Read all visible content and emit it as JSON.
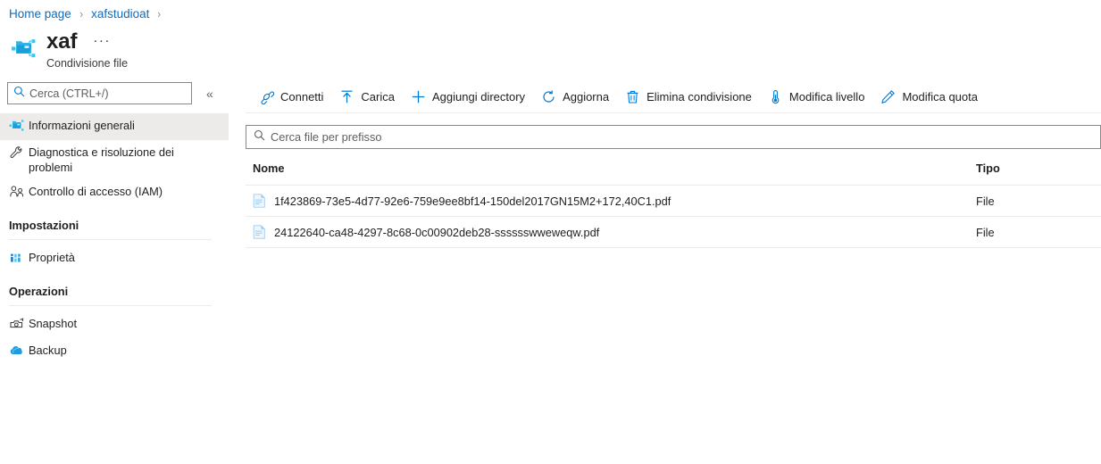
{
  "breadcrumb": {
    "items": [
      {
        "label": "Home page"
      },
      {
        "label": "xafstudioat"
      }
    ],
    "separator": "›"
  },
  "header": {
    "icon": "file-share-icon",
    "title": "xaf",
    "subtitle": "Condivisione file",
    "more_label": "···"
  },
  "sidebar": {
    "search": {
      "placeholder": "Cerca (CTRL+/)",
      "value": "",
      "icon": "search-icon"
    },
    "collapse_label": "«",
    "items": [
      {
        "label": "Informazioni generali",
        "icon": "file-share-icon",
        "selected": true
      },
      {
        "label": "Diagnostica e risoluzione dei problemi",
        "icon": "wrench-icon",
        "selected": false
      },
      {
        "label": "Controllo di accesso (IAM)",
        "icon": "people-icon",
        "selected": false
      }
    ],
    "groups": [
      {
        "title": "Impostazioni",
        "items": [
          {
            "label": "Proprietà",
            "icon": "properties-bars-icon"
          }
        ]
      },
      {
        "title": "Operazioni",
        "items": [
          {
            "label": "Snapshot",
            "icon": "camera-icon"
          },
          {
            "label": "Backup",
            "icon": "cloud-backup-icon"
          }
        ]
      }
    ]
  },
  "toolbar": {
    "commands": [
      {
        "label": "Connetti",
        "icon": "plug-connect-icon"
      },
      {
        "label": "Carica",
        "icon": "upload-arrow-icon"
      },
      {
        "label": "Aggiungi directory",
        "icon": "plus-icon"
      },
      {
        "label": "Aggiorna",
        "icon": "refresh-icon"
      },
      {
        "label": "Elimina condivisione",
        "icon": "trash-icon"
      },
      {
        "label": "Modifica livello",
        "icon": "thermometer-icon"
      },
      {
        "label": "Modifica quota",
        "icon": "pencil-icon"
      }
    ]
  },
  "file_browser": {
    "search": {
      "placeholder": "Cerca file per prefisso",
      "value": "",
      "icon": "search-icon"
    },
    "columns": [
      {
        "key": "name",
        "label": "Nome"
      },
      {
        "key": "type",
        "label": "Tipo"
      }
    ],
    "rows": [
      {
        "name": "1f423869-73e5-4d77-92e6-759e9ee8bf14-150del2017GN15M2+172,40C1.pdf",
        "type": "File",
        "icon": "document-icon"
      },
      {
        "name": "24122640-ca48-4297-8c68-0c00902deb28-sssssswweweqw.pdf",
        "type": "File",
        "icon": "document-icon"
      }
    ]
  },
  "colors": {
    "link": "#0f6cbd",
    "accent": "#0078d4",
    "icon_blue": "#0078d4",
    "selected_row": "#edebe9",
    "divider": "#edebe9",
    "text": "#201f1e",
    "placeholder": "#605e5c"
  }
}
